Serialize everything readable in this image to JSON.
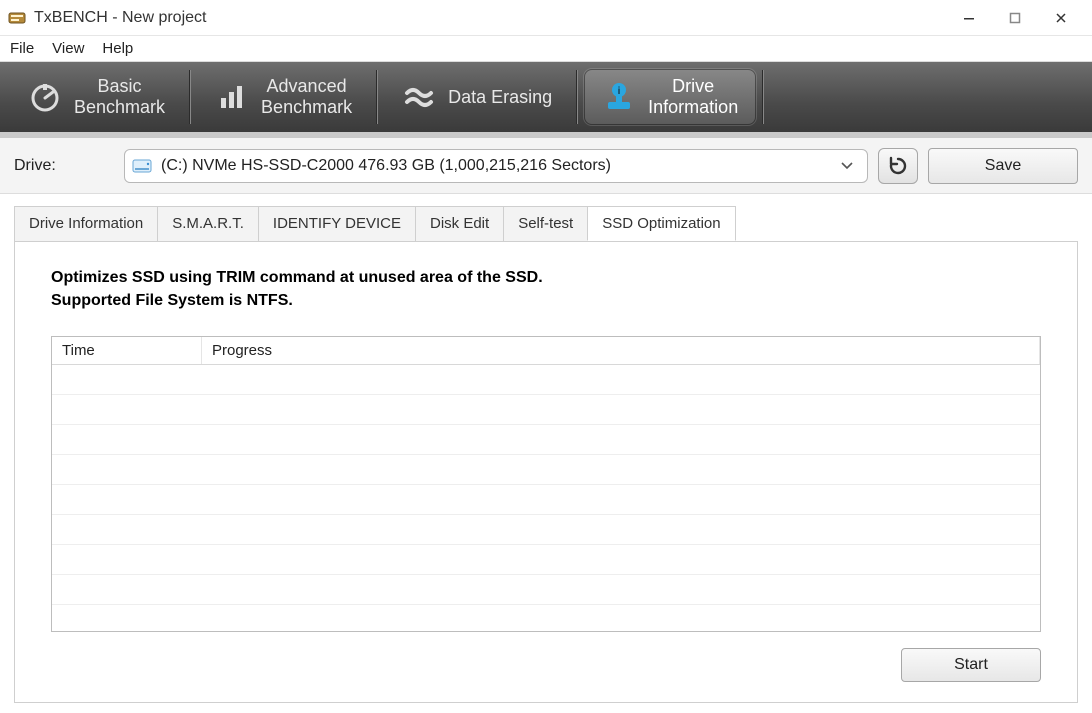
{
  "window": {
    "title": "TxBENCH - New project"
  },
  "menu": {
    "file": "File",
    "view": "View",
    "help": "Help"
  },
  "toolbar": {
    "basic": "Basic\nBenchmark",
    "advanced": "Advanced\nBenchmark",
    "erasing": "Data Erasing",
    "driveinfo": "Drive\nInformation"
  },
  "drive": {
    "label": "Drive:",
    "selected": "(C:) NVMe HS-SSD-C2000  476.93 GB (1,000,215,216 Sectors)",
    "save": "Save"
  },
  "subtabs": {
    "driveinfo": "Drive Information",
    "smart": "S.M.A.R.T.",
    "identify": "IDENTIFY DEVICE",
    "diskedit": "Disk Edit",
    "selftest": "Self-test",
    "ssdopt": "SSD Optimization"
  },
  "panel": {
    "desc_line1": "Optimizes SSD using TRIM command at unused area of the SSD.",
    "desc_line2": "Supported File System is NTFS.",
    "col_time": "Time",
    "col_progress": "Progress",
    "start": "Start"
  }
}
